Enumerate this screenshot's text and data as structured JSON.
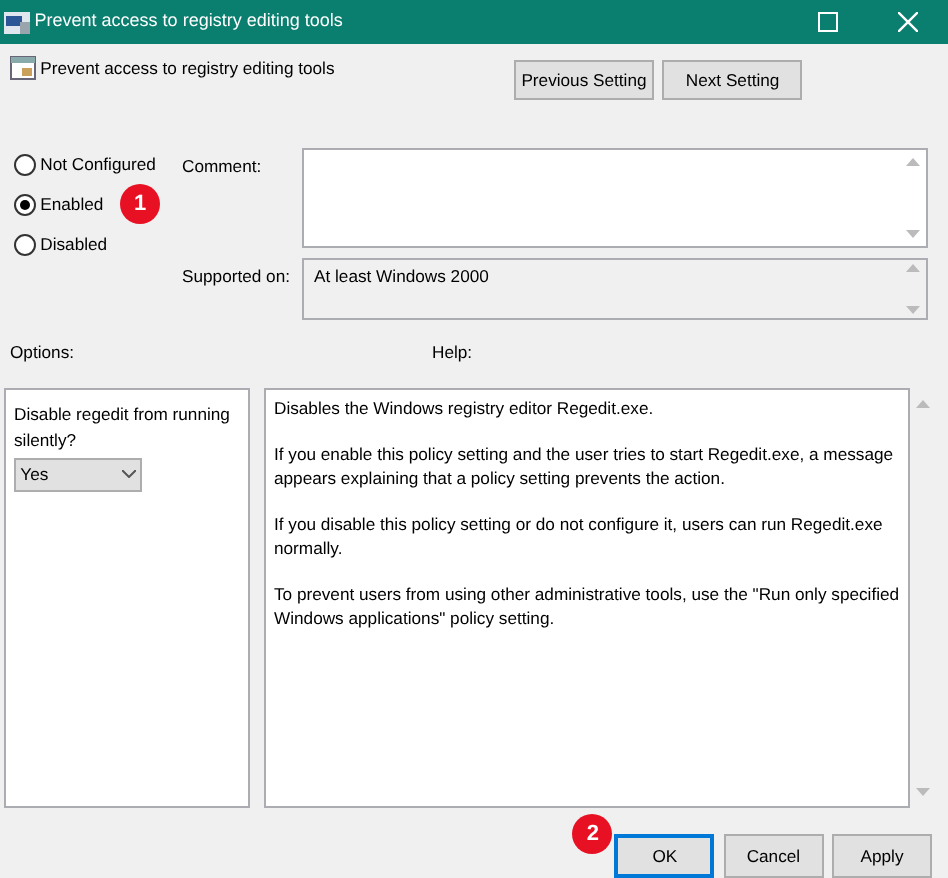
{
  "window": {
    "title": "Prevent access to registry editing tools"
  },
  "header": {
    "title": "Prevent access to registry editing tools",
    "buttons": [
      "Previous Setting",
      "Next Setting"
    ]
  },
  "state_options": [
    {
      "label": "Not Configured",
      "selected": false
    },
    {
      "label": "Enabled",
      "selected": true,
      "callout": "1"
    },
    {
      "label": "Disabled",
      "selected": false
    }
  ],
  "comment": {
    "label": "Comment:"
  },
  "supported_on": {
    "label": "Supported on:",
    "value": "At least Windows 2000"
  },
  "options": {
    "label": "Options:",
    "prompt": "Disable regedit from running silently?",
    "dropdown": "Yes"
  },
  "help": {
    "label": "Help:",
    "paragraphs": [
      "Disables the Windows registry editor Regedit.exe.",
      "If you enable this policy setting and the user tries to start Regedit.exe, a message appears explaining that a policy setting prevents the action.",
      "If you disable this policy setting or do not configure it, users can run Regedit.exe normally.",
      "To prevent users from using other administrative tools, use the \"Run only specified Windows applications\" policy setting."
    ]
  },
  "buttons": [
    {
      "label": "OK",
      "focused": true,
      "callout": "2"
    },
    {
      "label": "Cancel",
      "focused": false
    },
    {
      "label": "Apply",
      "focused": false
    }
  ]
}
